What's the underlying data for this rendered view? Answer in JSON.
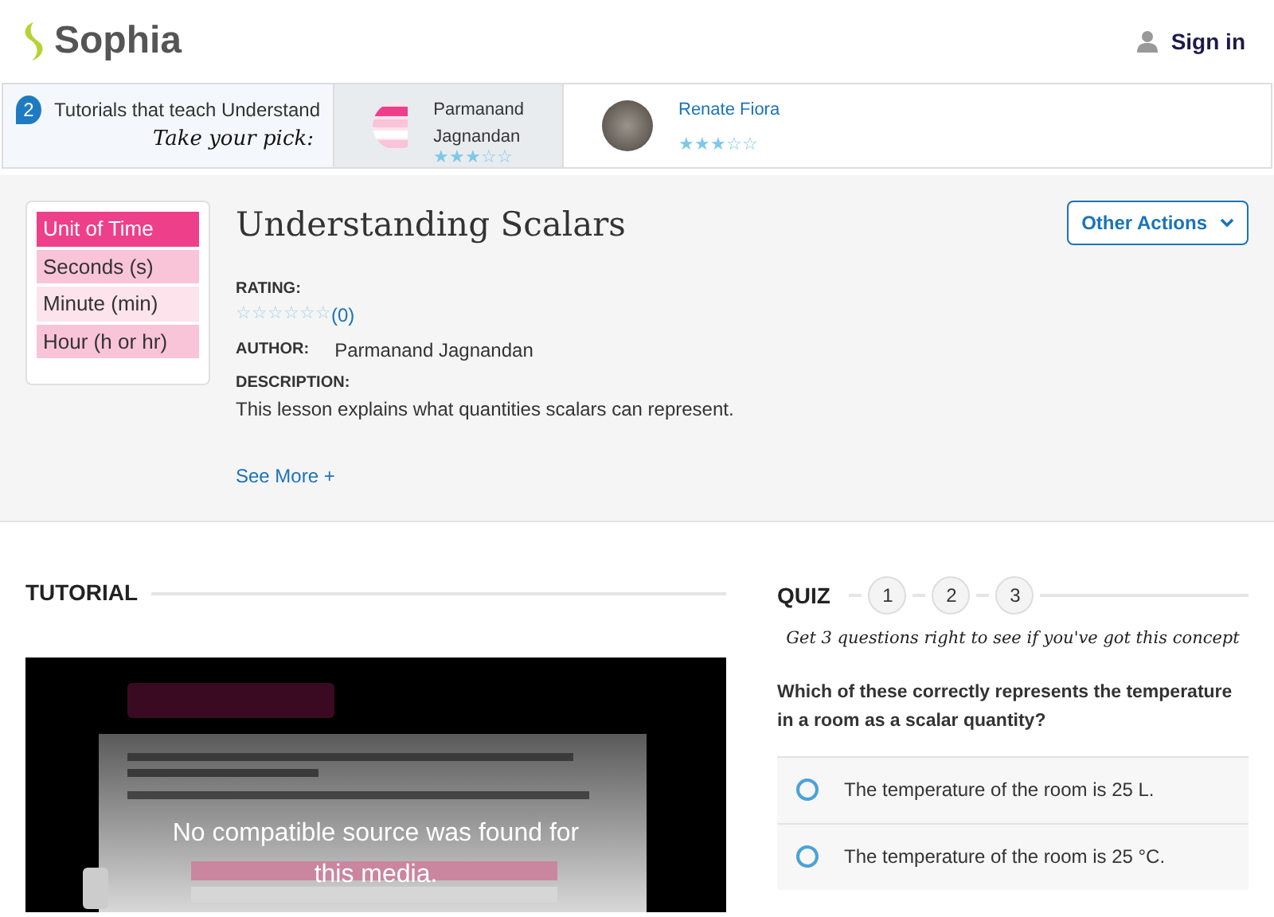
{
  "header": {
    "logo": "Sophia",
    "sign_in": "Sign in"
  },
  "picks": {
    "count": "2",
    "title": "Tutorials that teach Understand",
    "subtitle": "Take your pick:",
    "tutorials": [
      {
        "author": "Parmanand Jagnandan",
        "stars": 3,
        "selected": true,
        "kind": "thumb"
      },
      {
        "author": "Renate Fiora",
        "stars": 3,
        "selected": false,
        "kind": "avatar"
      }
    ]
  },
  "lesson": {
    "thumbnail": [
      {
        "text": "Unit of Time",
        "kind": "head"
      },
      {
        "text": "Seconds (s)",
        "kind": "dark"
      },
      {
        "text": "Minute (min)",
        "kind": "light"
      },
      {
        "text": "Hour (h or hr)",
        "kind": "dark"
      }
    ],
    "title": "Understanding Scalars",
    "actions": "Other Actions",
    "rating_label": "RATING:",
    "stars": 0,
    "rating_count": "(0)",
    "author_label": "AUTHOR:",
    "author": "Parmanand Jagnandan",
    "description_label": "DESCRIPTION:",
    "description": "This lesson explains what quantities scalars can represent.",
    "see_more": "See More +"
  },
  "tutorial": {
    "heading": "TUTORIAL",
    "video_message": "No compatible source was found for this media."
  },
  "quiz": {
    "heading": "QUIZ",
    "steps": [
      "1",
      "2",
      "3"
    ],
    "tagline": "Get 3 questions right to see if you've got this concept",
    "question": "Which of these correctly represents the temperature in a room as a scalar quantity?",
    "answers": [
      {
        "text": "The temperature of the room is 25 L.",
        "selected": false
      },
      {
        "text": "The temperature of the room is 25 °C.",
        "selected": false
      }
    ]
  }
}
